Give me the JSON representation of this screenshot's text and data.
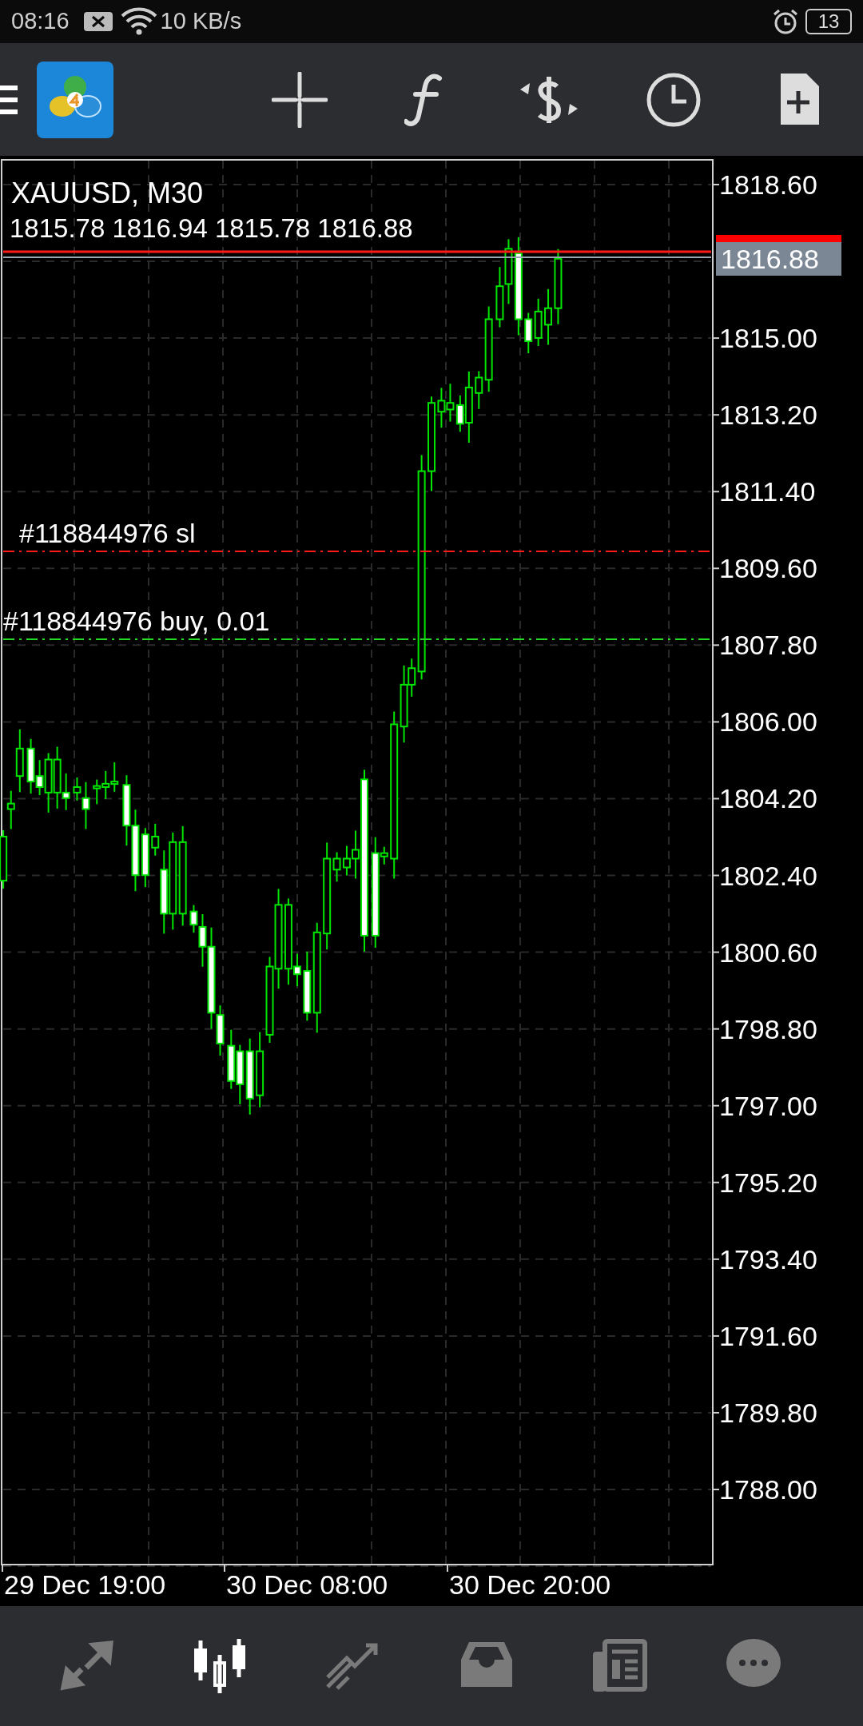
{
  "status_bar": {
    "time": "08:16",
    "network_speed": "10 KB/s",
    "battery": "13"
  },
  "chart": {
    "symbol": "XAUUSD, M30",
    "ohlc": "1815.78 1816.94 1815.78 1816.88",
    "current_price": "1816.88",
    "order_lines": [
      {
        "label": "#118844976 sl",
        "kind": "stop_loss"
      },
      {
        "label": "#118844976 buy, 0.01",
        "kind": "entry"
      }
    ],
    "price_axis": [
      "1818.60",
      "1815.00",
      "1813.20",
      "1811.40",
      "1809.60",
      "1807.80",
      "1806.00",
      "1804.20",
      "1802.40",
      "1800.60",
      "1798.80",
      "1797.00",
      "1795.20",
      "1793.40",
      "1791.60",
      "1789.80",
      "1788.00"
    ],
    "time_axis": [
      "29 Dec 19:00",
      "30 Dec 08:00",
      "30 Dec 20:00"
    ]
  },
  "bottom_nav": [
    {
      "kind": "trade",
      "selected": false
    },
    {
      "kind": "chart",
      "selected": true
    },
    {
      "kind": "history",
      "selected": false
    },
    {
      "kind": "inbox",
      "selected": false
    },
    {
      "kind": "news",
      "selected": false
    },
    {
      "kind": "chat",
      "selected": false
    }
  ]
}
